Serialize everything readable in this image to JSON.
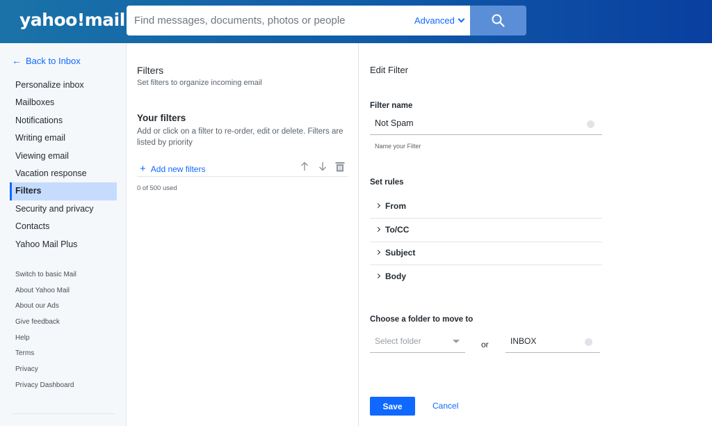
{
  "header": {
    "logo": "yahoo!mail",
    "search_placeholder": "Find messages, documents, photos or people",
    "advanced_label": "Advanced",
    "search_icon": "search-icon"
  },
  "sidebar": {
    "back_label": "Back to Inbox",
    "items": [
      {
        "label": "Personalize inbox"
      },
      {
        "label": "Mailboxes"
      },
      {
        "label": "Notifications"
      },
      {
        "label": "Writing email"
      },
      {
        "label": "Viewing email"
      },
      {
        "label": "Vacation response"
      },
      {
        "label": "Filters",
        "active": true
      },
      {
        "label": "Security and privacy"
      },
      {
        "label": "Contacts"
      },
      {
        "label": "Yahoo Mail Plus"
      }
    ],
    "links": [
      {
        "label": "Switch to basic Mail"
      },
      {
        "label": "About Yahoo Mail"
      },
      {
        "label": "About our Ads"
      },
      {
        "label": "Give feedback"
      },
      {
        "label": "Help"
      },
      {
        "label": "Terms"
      },
      {
        "label": "Privacy"
      },
      {
        "label": "Privacy Dashboard"
      }
    ]
  },
  "filters": {
    "title": "Filters",
    "subtitle": "Set filters to organize incoming email",
    "your_filters_title": "Your filters",
    "your_filters_desc": "Add or click on a filter to re-order, edit or delete. Filters are listed by priority",
    "add_new_label": "Add new filters",
    "used_text": "0 of 500 used",
    "icons": [
      "arrow-up-icon",
      "arrow-down-icon",
      "trash-icon"
    ]
  },
  "edit": {
    "title": "Edit Filter",
    "filter_name_label": "Filter name",
    "filter_name_value": "Not Spam",
    "filter_name_hint": "Name your Filter",
    "set_rules_label": "Set rules",
    "rules": [
      {
        "label": "From"
      },
      {
        "label": "To/CC"
      },
      {
        "label": "Subject"
      },
      {
        "label": "Body"
      }
    ],
    "folder_label": "Choose a folder to move to",
    "folder_placeholder": "Select folder",
    "or_label": "or",
    "folder_input_value": "INBOX",
    "save_label": "Save",
    "cancel_label": "Cancel"
  },
  "colors": {
    "accent": "#0f69ff",
    "header_start": "#1a73a8",
    "header_end": "#0a3fa0",
    "active_nav_bg": "#c6dcff"
  }
}
